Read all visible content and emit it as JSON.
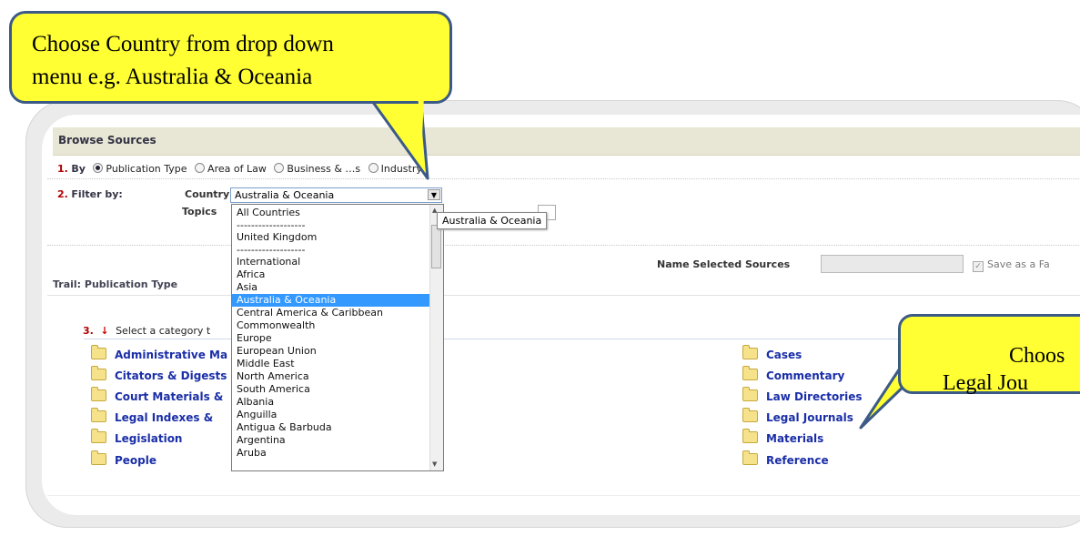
{
  "callouts": {
    "country": {
      "line1": "Choose Country from drop down",
      "line2": "menu e.g. Australia & Oceania"
    },
    "journals": {
      "line1": "Choos",
      "line2": "Legal Jou"
    }
  },
  "browse": {
    "header": "Browse Sources",
    "step1": {
      "num": "1.",
      "label": "By",
      "options": [
        "Publication Type",
        "Area of Law",
        "Business & …s",
        "Industry"
      ]
    },
    "step2": {
      "num": "2.",
      "label": "Filter by:",
      "country_label": "Country",
      "country_value": "Australia & Oceania",
      "topics_label": "Topics"
    },
    "tooltip": "Australia & Oceania",
    "dropdown_options": [
      "All Countries",
      "-------------------",
      "United Kingdom",
      "-------------------",
      "International",
      "Africa",
      "Asia",
      "Australia & Oceania",
      "Central America & Caribbean",
      "Commonwealth",
      "Europe",
      "European Union",
      "Middle East",
      "North America",
      "South America",
      "Albania",
      "Anguilla",
      "Antigua & Barbuda",
      "Argentina",
      "Aruba"
    ],
    "selected_index": 7,
    "trail": "Trail: Publication Type",
    "name_selected_label": "Name Selected Sources",
    "save_label": "Save as a Fa",
    "step3": {
      "num": "3.",
      "text": "Select a category t"
    },
    "left_categories": [
      "Administrative Ma",
      "Citators & Digests",
      "Court Materials &",
      "Legal Indexes &",
      "Legislation",
      "People"
    ],
    "right_categories": [
      "Cases",
      "Commentary",
      "Law Directories",
      "Legal Journals",
      "Materials",
      "Reference"
    ]
  },
  "colors": {
    "callout_fill": "#ffff33",
    "callout_border": "#3c5a86",
    "link": "#1a2ea8",
    "selected": "#3399ff",
    "step_number": "#b00000"
  },
  "icons": {
    "folder": "folder-icon",
    "arrow": "red-down-arrow-icon",
    "dropdown": "chevron-down-icon"
  }
}
